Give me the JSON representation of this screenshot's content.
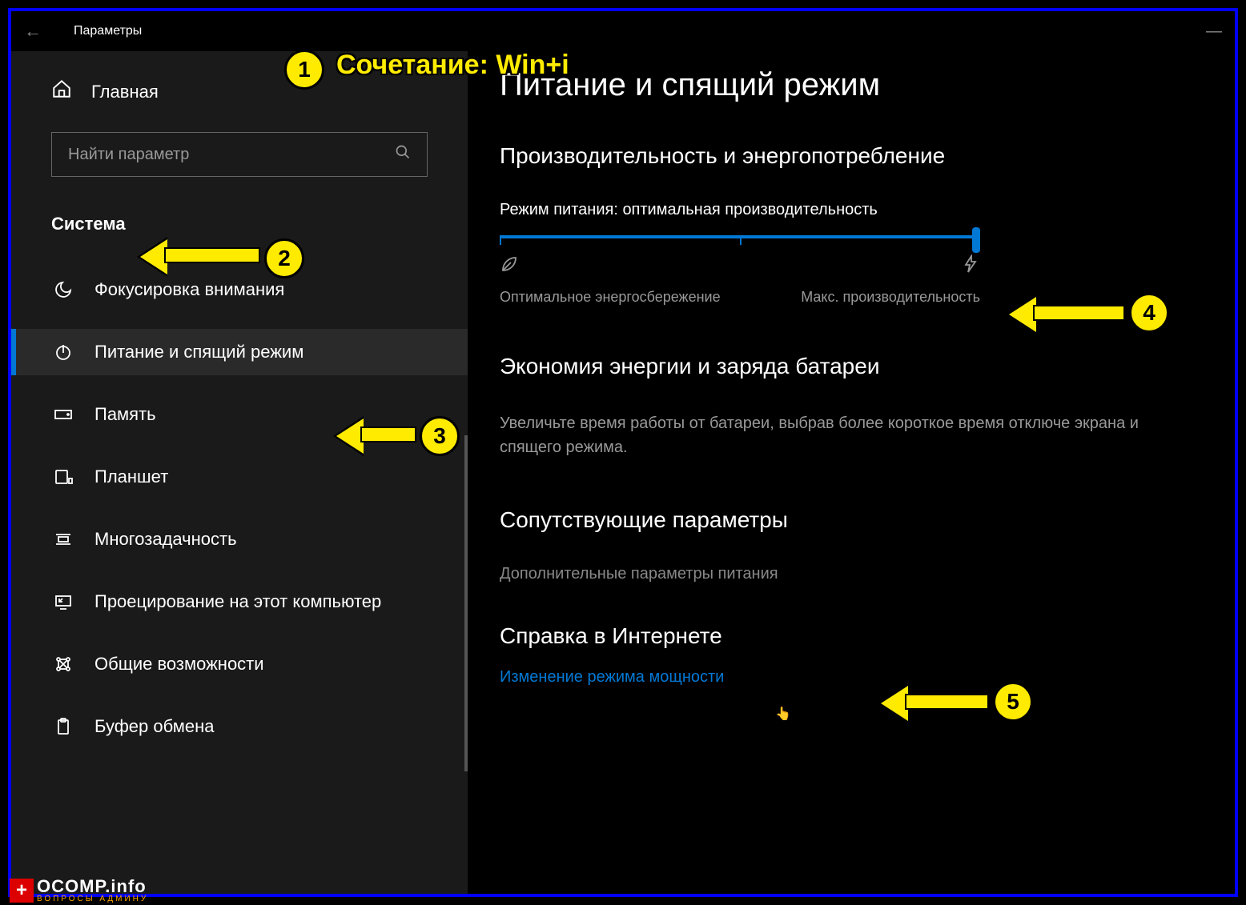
{
  "window": {
    "title": "Параметры"
  },
  "sidebar": {
    "home": "Главная",
    "search_placeholder": "Найти параметр",
    "category": "Система",
    "items": [
      {
        "label": "Фокусировка внимания",
        "icon": "moon"
      },
      {
        "label": "Питание и спящий режим",
        "icon": "power",
        "selected": true
      },
      {
        "label": "Память",
        "icon": "storage"
      },
      {
        "label": "Планшет",
        "icon": "tablet"
      },
      {
        "label": "Многозадачность",
        "icon": "multitask"
      },
      {
        "label": "Проецирование на этот компьютер",
        "icon": "project"
      },
      {
        "label": "Общие возможности",
        "icon": "shared"
      },
      {
        "label": "Буфер обмена",
        "icon": "clipboard"
      }
    ]
  },
  "main": {
    "title": "Питание и спящий режим",
    "perf_section": "Производительность и энергопотребление",
    "mode_label": "Режим питания: оптимальная производительность",
    "slider_left": "Оптимальное энергосбережение",
    "slider_right": "Макс. производительность",
    "battery_section": "Экономия энергии и заряда батареи",
    "battery_desc": "Увеличьте время работы от батареи, выбрав более короткое время отключе экрана и спящего режима.",
    "related_section": "Сопутствующие параметры",
    "related_link": "Дополнительные параметры питания",
    "help_section": "Справка в Интернете",
    "help_link": "Изменение режима мощности"
  },
  "annotations": {
    "a1_text": "Сочетание: Win+i",
    "n1": "1",
    "n2": "2",
    "n3": "3",
    "n4": "4",
    "n5": "5"
  },
  "watermark": {
    "main": "OCOMP.info",
    "sub": "ВОПРОСЫ АДМИНУ"
  }
}
